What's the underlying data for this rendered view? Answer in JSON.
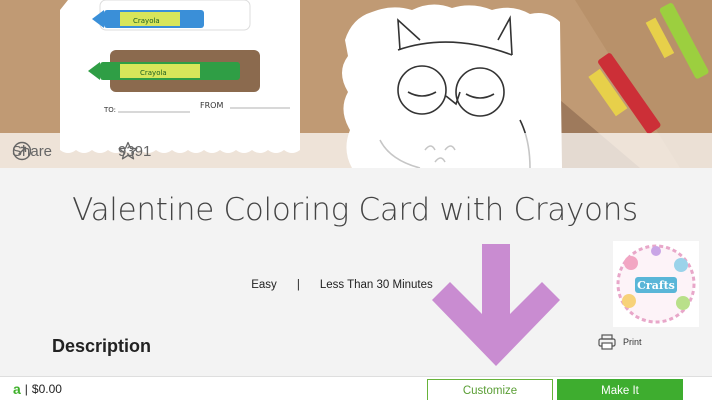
{
  "hero": {
    "card_to_label": "TO:",
    "card_from_label": "FROM",
    "crayon_brand": "Crayola",
    "share_label": "Share",
    "favorite_count": "9391"
  },
  "project": {
    "title": "Valentine Coloring Card with Crayons",
    "difficulty": "Easy",
    "separator": "|",
    "duration": "Less Than 30 Minutes",
    "description_heading": "Description",
    "print_label": "Print"
  },
  "logo_badge": {
    "text": "Crafts"
  },
  "footer": {
    "access_icon": "a",
    "price": "$0.00",
    "price_separator": "|",
    "customize_label": "Customize",
    "make_it_label": "Make It"
  },
  "colors": {
    "accent_green": "#3ead2f",
    "arrow_purple": "#c98cd1",
    "kraft_background": "#c09a74"
  },
  "icons": {
    "share": "share-arrow-icon",
    "favorite": "star-icon",
    "print": "printer-icon",
    "access": "cricut-access-icon"
  }
}
